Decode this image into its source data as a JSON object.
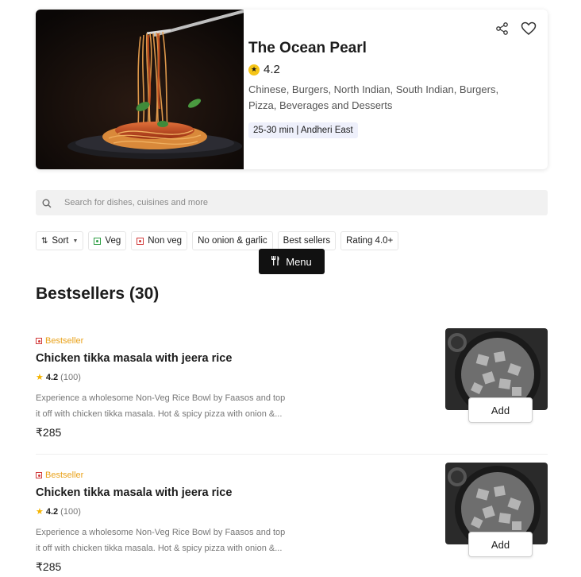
{
  "restaurant": {
    "name": "The Ocean Pearl",
    "rating": "4.2",
    "cuisines": "Chinese, Burgers, North Indian, South Indian, Burgers, Pizza, Beverages and Desserts",
    "delivery_time": "25-30 min",
    "location": "| Andheri East",
    "hero_image_icon": "spaghetti-image"
  },
  "search": {
    "placeholder": "Search for dishes, cuisines and more"
  },
  "filters": {
    "sort": "Sort",
    "veg": "Veg",
    "nonveg": "Non veg",
    "no_onion": "No onion & garlic",
    "best_sellers": "Best sellers",
    "rating": "Rating 4.0+"
  },
  "menu_button": "Menu",
  "section": {
    "title": "Bestsellers (30)"
  },
  "dishes": [
    {
      "tag": "Bestseller",
      "name": "Chicken tikka masala with jeera rice",
      "rating": "4.2",
      "rating_count": "(100)",
      "desc_line1": "Experience a wholesome Non-Veg Rice Bowl by Faasos and top",
      "desc_line2": "it off with chicken tikka masala. Hot & spicy pizza with onion &...",
      "price": "₹285",
      "add_label": "Add"
    },
    {
      "tag": "Bestseller",
      "name": "Chicken tikka masala with jeera rice",
      "rating": "4.2",
      "rating_count": "(100)",
      "desc_line1": "Experience a wholesome Non-Veg Rice Bowl by Faasos and top",
      "desc_line2": "it off with chicken tikka masala. Hot & spicy pizza with onion &...",
      "price": "₹285",
      "add_label": "Add"
    }
  ],
  "colors": {
    "bestseller": "#e9a21a",
    "veg": "#2e9e44",
    "nonveg": "#d13a3a",
    "star": "#f5c518",
    "menu_bg": "#111111"
  }
}
